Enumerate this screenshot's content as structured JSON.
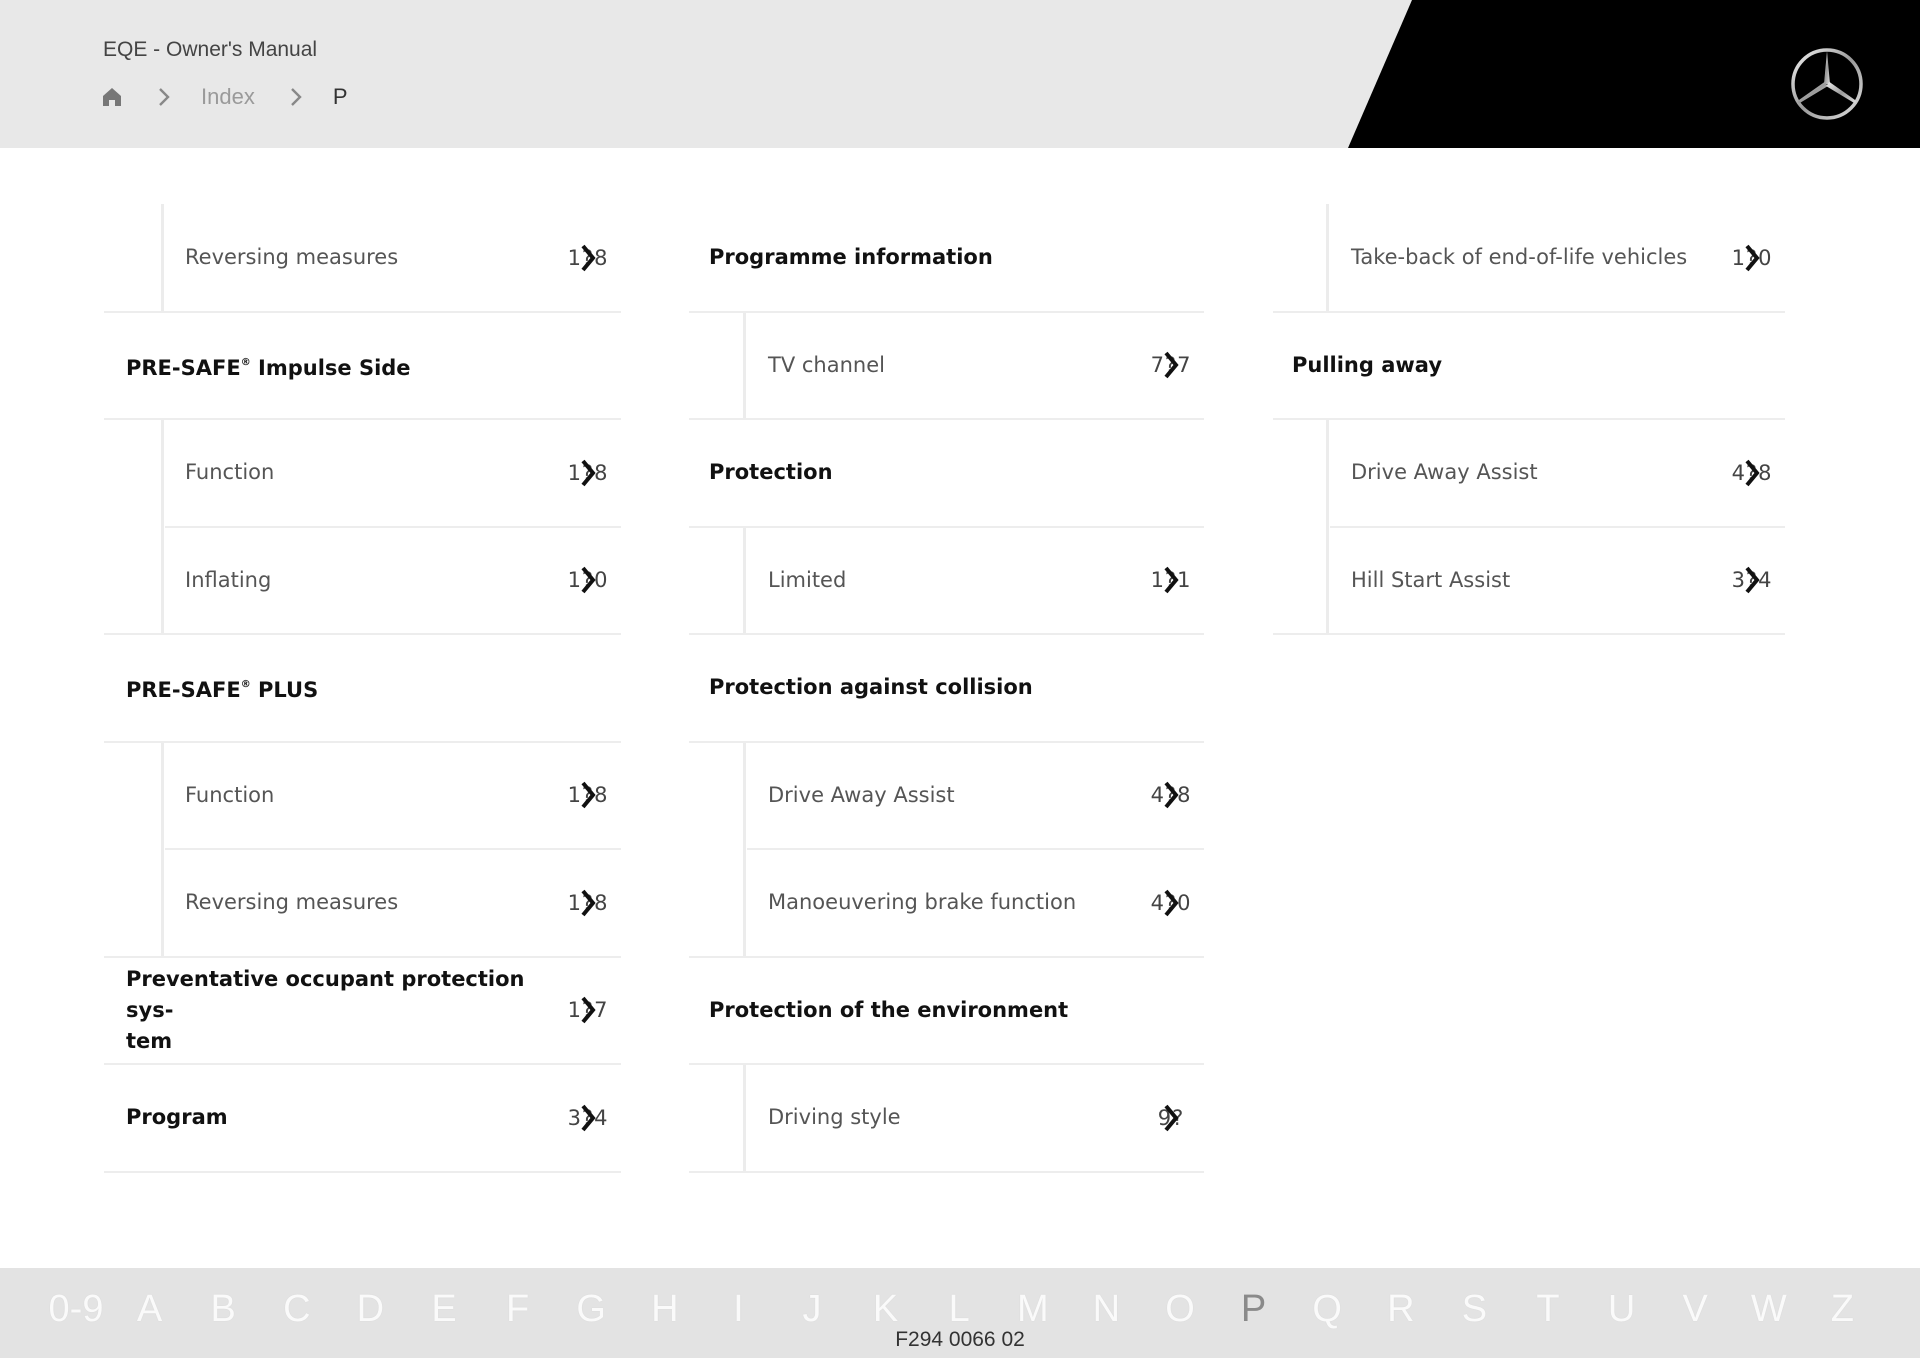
{
  "header": {
    "title": "EQE - Owner's Manual",
    "breadcrumb": {
      "home_icon": "home-icon",
      "separator_icon": "chevron-right-icon",
      "index_label": "Index",
      "current": "P"
    },
    "logo": "mercedes-star-logo"
  },
  "columns": [
    {
      "rows": [
        {
          "type": "sub",
          "label": "Reversing measures",
          "page": "1?8"
        },
        {
          "type": "head",
          "label": "PRE-SAFE",
          "sup": "®",
          "label_suffix": " Impulse Side",
          "page": ""
        },
        {
          "type": "sub",
          "label": "Function",
          "page": "1?8"
        },
        {
          "type": "sub",
          "label": "Inflating",
          "page": "1?0"
        },
        {
          "type": "head",
          "label": "PRE-SAFE",
          "sup": "®",
          "label_suffix": " PLUS",
          "page": ""
        },
        {
          "type": "sub",
          "label": "Function",
          "page": "1?8"
        },
        {
          "type": "sub",
          "label": "Reversing measures",
          "page": "1?8"
        },
        {
          "type": "head",
          "label": "Preventative occupant protection sys-",
          "label_line2": "tem",
          "page": "1?7"
        },
        {
          "type": "head",
          "label": "Program",
          "page": "3?4"
        }
      ]
    },
    {
      "rows": [
        {
          "type": "head",
          "label": "Programme information",
          "page": ""
        },
        {
          "type": "sub",
          "label": "TV channel",
          "page": "7?7"
        },
        {
          "type": "head",
          "label": "Protection",
          "page": ""
        },
        {
          "type": "sub",
          "label": "Limited",
          "page": "1?1"
        },
        {
          "type": "head",
          "label": "Protection against collision",
          "page": ""
        },
        {
          "type": "sub",
          "label": "Drive Away Assist",
          "page": "4?8"
        },
        {
          "type": "sub",
          "label": "Manoeuvering brake function",
          "page": "4?0"
        },
        {
          "type": "head",
          "label": "Protection of the environment",
          "page": ""
        },
        {
          "type": "sub",
          "label": "Driving style",
          "page": "9?"
        }
      ]
    },
    {
      "rows": [
        {
          "type": "sub",
          "label": "Take-back of end-of-life vehicles",
          "page": "1?0"
        },
        {
          "type": "head",
          "label": "Pulling away",
          "page": ""
        },
        {
          "type": "sub",
          "label": "Drive Away Assist",
          "page": "4?8"
        },
        {
          "type": "sub",
          "label": "Hill Start Assist",
          "page": "3?4"
        }
      ]
    }
  ],
  "alphabet": {
    "letters": [
      "0-9",
      "A",
      "B",
      "C",
      "D",
      "E",
      "F",
      "G",
      "H",
      "I",
      "J",
      "K",
      "L",
      "M",
      "N",
      "O",
      "P",
      "Q",
      "R",
      "S",
      "T",
      "U",
      "V",
      "W",
      "Z"
    ],
    "active": "P"
  },
  "footer": {
    "code": "F294 0066 02"
  },
  "colors": {
    "header_bg": "#e8e8e8",
    "header_black": "#000000",
    "divider": "#ededed",
    "footer_bg": "#e3e3e3",
    "active_letter": "#8a8a8a"
  }
}
